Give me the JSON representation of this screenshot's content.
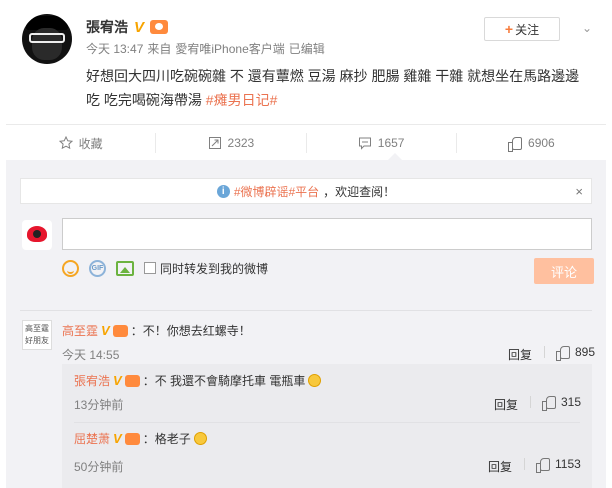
{
  "post": {
    "author": "張宥浩",
    "time": "今天 13:47",
    "source_prefix": "来自",
    "source": "愛宥唯iPhone客户端",
    "edited": "已编辑",
    "follow_label": "关注",
    "text": "好想回大四川吃碗碗雜 不 還有蕈燃 豆湯 麻抄 肥腸 雞雜 干雜 就想坐在馬路邊邊吃 吃完喝碗海帶湯 ",
    "hashtag": "#瘫男日记#"
  },
  "actions": {
    "favorite": "收藏",
    "repost": "2323",
    "comment": "1657",
    "like": "6906"
  },
  "notice": {
    "prefix": "",
    "link": "#微博辟谣#平台",
    "suffix": "，欢迎查阅！",
    "close": "×"
  },
  "composer": {
    "placeholder": "",
    "forward_label": "同时转发到我的微博",
    "submit": "评论"
  },
  "comments": [
    {
      "name": "高至霆",
      "text": "：不！你想去红螺寺！",
      "time": "今天 14:55",
      "reply": "回复",
      "likes": "895",
      "avatar_text": "高至霆 好朋友"
    }
  ],
  "replies": [
    {
      "name": "張宥浩",
      "text": "：不 我還不會騎摩托車 電瓶車",
      "time": "13分钟前",
      "reply": "回复",
      "likes": "315"
    },
    {
      "name": "屈楚萧",
      "text": "：格老子",
      "time": "50分钟前",
      "reply": "回复",
      "likes": "1153"
    }
  ],
  "colors": {
    "accent": "#eb7350",
    "verified": "#f7a400",
    "submit_disabled": "#ffc09f"
  }
}
